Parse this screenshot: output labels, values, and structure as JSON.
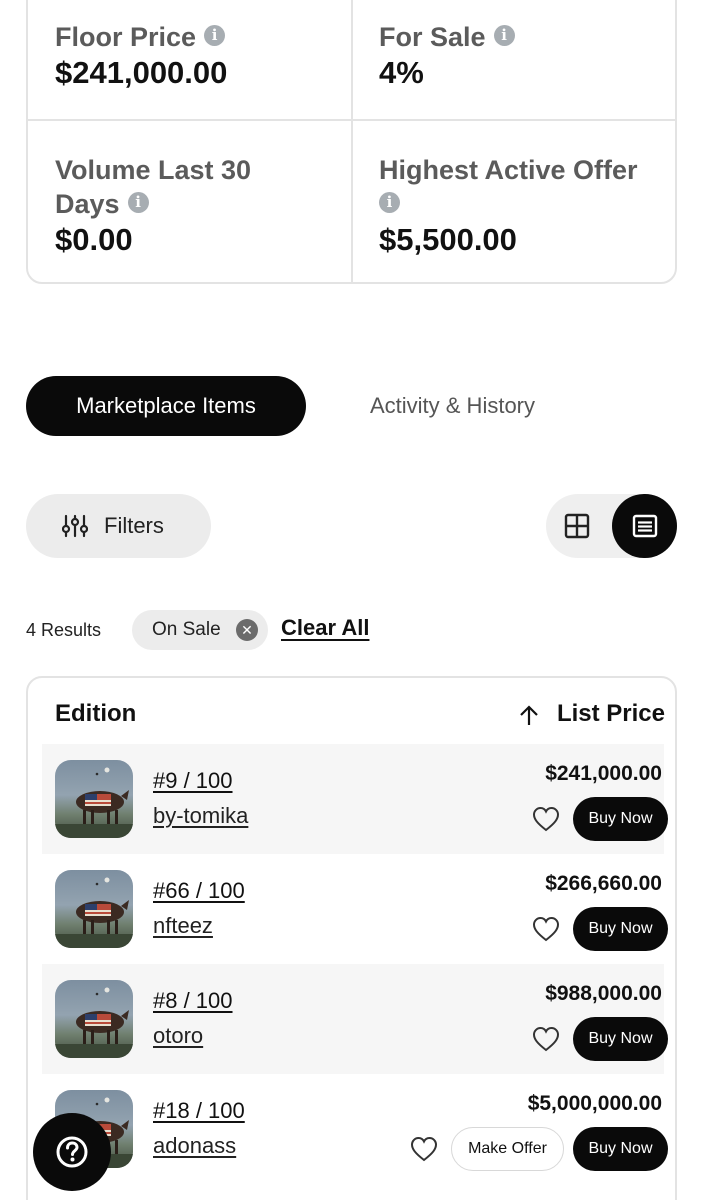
{
  "stats": {
    "floor_price": {
      "label": "Floor Price",
      "value": "$241,000.00"
    },
    "for_sale": {
      "label": "For Sale",
      "value": "4%"
    },
    "volume": {
      "label_line1": "Volume Last 30",
      "label_line2": "Days",
      "value": "$0.00"
    },
    "highest_offer": {
      "label": "Highest Active Offer",
      "value": "$5,500.00"
    },
    "info_icon": "info-icon"
  },
  "tabs": [
    {
      "label": "Marketplace Items",
      "active": true
    },
    {
      "label": "Activity & History",
      "active": false
    }
  ],
  "toolbar": {
    "filters_label": "Filters",
    "view_modes": [
      "grid",
      "list"
    ],
    "active_view": "list"
  },
  "results": {
    "count_label": "4 Results",
    "chip_label": "On Sale",
    "clear_label": "Clear All"
  },
  "table": {
    "col_edition": "Edition",
    "col_price": "List Price",
    "sort_direction": "ascending",
    "rows": [
      {
        "edition": "#9 / 100",
        "owner": "by-tomika",
        "price": "$241,000.00",
        "buy": "Buy Now",
        "offer": null
      },
      {
        "edition": "#66 / 100",
        "owner": "nfteez",
        "price": "$266,660.00",
        "buy": "Buy Now",
        "offer": null
      },
      {
        "edition": "#8 / 100",
        "owner": "otoro",
        "price": "$988,000.00",
        "buy": "Buy Now",
        "offer": null
      },
      {
        "edition": "#18 / 100",
        "owner": "adonass",
        "price": "$5,000,000.00",
        "buy": "Buy Now",
        "offer": "Make Offer"
      }
    ]
  },
  "help": {
    "icon": "question-icon"
  },
  "colors": {
    "accent": "#0a0a0a",
    "muted_bg": "#ececec",
    "border": "#e3e3e3",
    "info_icon": "#a7adb2"
  }
}
